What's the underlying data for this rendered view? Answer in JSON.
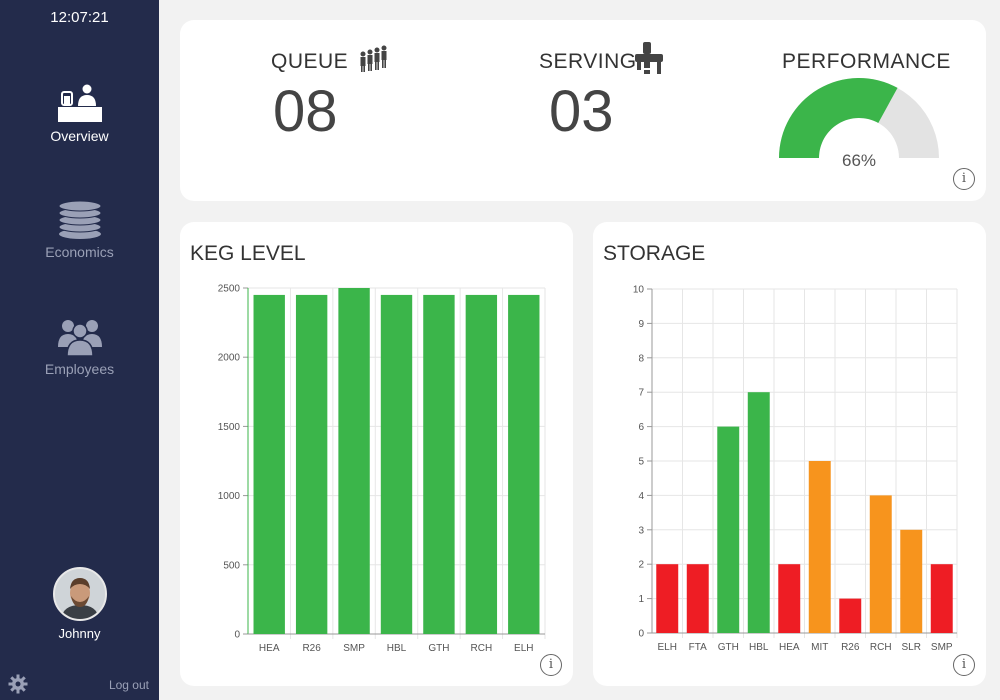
{
  "sidebar": {
    "clock": "12:07:21",
    "items": [
      {
        "label": "Overview",
        "icon": "bar-counter-icon",
        "active": true
      },
      {
        "label": "Economics",
        "icon": "coins-icon",
        "active": false
      },
      {
        "label": "Employees",
        "icon": "group-icon",
        "active": false
      }
    ],
    "user": {
      "name": "Johnny"
    },
    "logout_label": "Log out",
    "settings_icon": "gear-icon"
  },
  "stats": {
    "queue": {
      "label": "QUEUE",
      "value": "08",
      "icon": "people-queue-icon"
    },
    "serving": {
      "label": "SERVING",
      "value": "03",
      "icon": "beer-tap-icon"
    },
    "performance": {
      "label": "PERFORMANCE",
      "value": 0.66,
      "display": "66%"
    }
  },
  "colors": {
    "sidebar_bg": "#232b4b",
    "green": "#3bb54a",
    "red": "#ee1d24",
    "orange": "#f7941d",
    "gauge_empty": "#e3e3e3"
  },
  "keg": {
    "title": "KEG LEVEL"
  },
  "storage": {
    "title": "STORAGE"
  },
  "chart_data": [
    {
      "type": "bar",
      "categories": [
        "HEA",
        "R26",
        "SMP",
        "HBL",
        "GTH",
        "RCH",
        "ELH"
      ],
      "values": [
        2450,
        2450,
        2500,
        2450,
        2450,
        2450,
        2450
      ],
      "ylim": [
        0,
        2500
      ],
      "yticks": [
        0,
        500,
        1000,
        1500,
        2000,
        2500
      ],
      "colors": [
        "#3bb54a",
        "#3bb54a",
        "#3bb54a",
        "#3bb54a",
        "#3bb54a",
        "#3bb54a",
        "#3bb54a"
      ],
      "grid": true
    },
    {
      "type": "bar",
      "categories": [
        "ELH",
        "FTA",
        "GTH",
        "HBL",
        "HEA",
        "MIT",
        "R26",
        "RCH",
        "SLR",
        "SMP"
      ],
      "values": [
        2,
        2,
        6,
        7,
        2,
        5,
        1,
        4,
        3,
        2
      ],
      "ylim": [
        0,
        10
      ],
      "yticks": [
        0,
        1,
        2,
        3,
        4,
        5,
        6,
        7,
        8,
        9,
        10
      ],
      "colors": [
        "#ee1d24",
        "#ee1d24",
        "#3bb54a",
        "#3bb54a",
        "#ee1d24",
        "#f7941d",
        "#ee1d24",
        "#f7941d",
        "#f7941d",
        "#ee1d24"
      ],
      "grid": true
    }
  ]
}
